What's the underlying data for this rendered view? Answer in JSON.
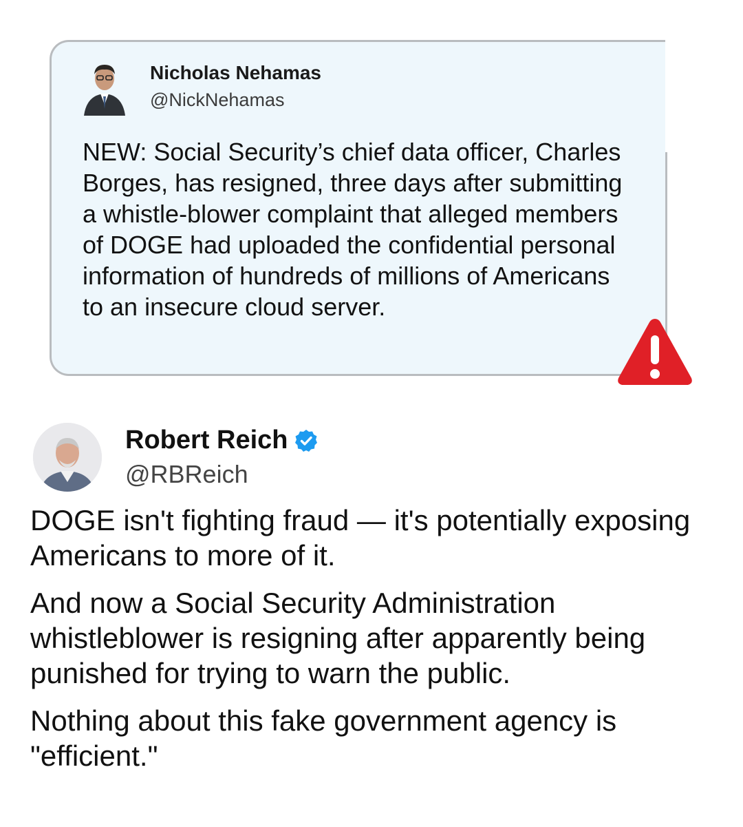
{
  "quoted_tweet": {
    "author_name": "Nicholas Nehamas",
    "author_handle": "@NickNehamas",
    "text": "NEW: Social Security’s chief data officer, Charles Borges, has resigned, three days after submitting a whistle-blower complaint that alleged members of DOGE had uploaded the confidential personal information of hundreds of millions of Americans to an insecure cloud server.",
    "badge_icon": "warning-icon",
    "badge_color": "#e02027"
  },
  "main_tweet": {
    "author_name": "Robert Reich",
    "author_handle": "@RBReich",
    "verified_icon": "verified-badge-icon",
    "verified_color": "#1d9bf0",
    "paragraphs": [
      "DOGE isn't fighting fraud — it's potentially exposing Americans to more of it.",
      "And now a Social Security Administration whistleblower is resigning after apparently being punished for trying to warn the public.",
      "Nothing about this fake government agency is \"efficient.\""
    ]
  }
}
